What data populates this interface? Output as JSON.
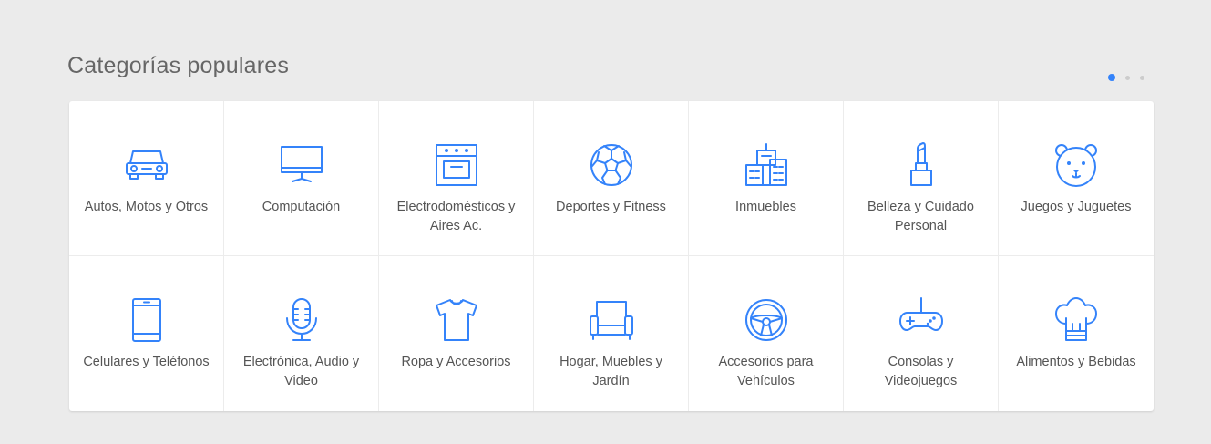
{
  "section": {
    "title": "Categorías populares"
  },
  "pager": {
    "pages": 3,
    "active": 0
  },
  "colors": {
    "accent": "#3483fa",
    "text": "#555555",
    "title": "#666666",
    "background": "#ebebeb"
  },
  "categories": [
    {
      "label": "Autos, Motos y Otros",
      "icon": "car-icon"
    },
    {
      "label": "Computación",
      "icon": "monitor-icon"
    },
    {
      "label": "Electrodomésticos y Aires Ac.",
      "icon": "oven-icon"
    },
    {
      "label": "Deportes y Fitness",
      "icon": "soccer-ball-icon"
    },
    {
      "label": "Inmuebles",
      "icon": "buildings-icon"
    },
    {
      "label": "Belleza y Cuidado Personal",
      "icon": "lipstick-icon"
    },
    {
      "label": "Juegos y Juguetes",
      "icon": "teddy-bear-icon"
    },
    {
      "label": "Celulares y Teléfonos",
      "icon": "cellphone-icon"
    },
    {
      "label": "Electrónica, Audio y Video",
      "icon": "microphone-icon"
    },
    {
      "label": "Ropa y Accesorios",
      "icon": "tshirt-icon"
    },
    {
      "label": "Hogar, Muebles y Jardín",
      "icon": "armchair-icon"
    },
    {
      "label": "Accesorios para Vehículos",
      "icon": "steering-wheel-icon"
    },
    {
      "label": "Consolas y Videojuegos",
      "icon": "gamepad-icon"
    },
    {
      "label": "Alimentos y Bebidas",
      "icon": "chef-hat-icon"
    }
  ]
}
